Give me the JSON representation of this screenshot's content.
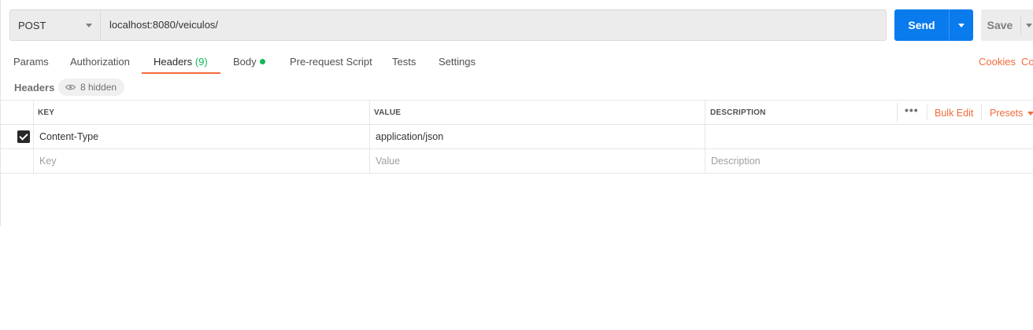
{
  "request": {
    "method": "POST",
    "url": "localhost:8080/veiculos/",
    "send_label": "Send",
    "save_label": "Save"
  },
  "tabs": [
    {
      "label": "Params"
    },
    {
      "label": "Authorization"
    },
    {
      "label": "Headers",
      "count": "(9)",
      "active": true
    },
    {
      "label": "Body",
      "has_content": true
    },
    {
      "label": "Pre-request Script"
    },
    {
      "label": "Tests"
    },
    {
      "label": "Settings"
    }
  ],
  "links": {
    "cookies": "Cookies",
    "code": "Co"
  },
  "headers_section": {
    "title": "Headers",
    "hidden_label": "8 hidden"
  },
  "table": {
    "columns": {
      "key": "KEY",
      "value": "VALUE",
      "description": "DESCRIPTION"
    },
    "actions": {
      "more": "•••",
      "bulk_edit": "Bulk Edit",
      "presets": "Presets"
    },
    "rows": [
      {
        "checked": true,
        "key": "Content-Type",
        "value": "application/json",
        "description": ""
      }
    ],
    "placeholders": {
      "key": "Key",
      "value": "Value",
      "description": "Description"
    }
  },
  "colors": {
    "accent": "#f26b3a",
    "send": "#097bed",
    "body_dot": "#0cbb52"
  }
}
